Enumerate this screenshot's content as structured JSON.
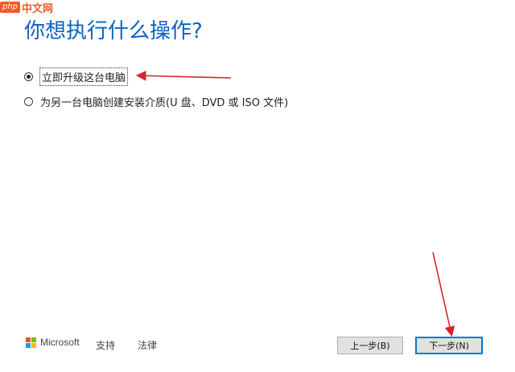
{
  "watermark": {
    "logo": "php",
    "text": "中文网"
  },
  "heading": "你想执行什么操作?",
  "options": [
    {
      "label": "立即升级这台电脑",
      "checked": true
    },
    {
      "label": "为另一台电脑创建安装介质(U 盘、DVD 或 ISO 文件)",
      "checked": false
    }
  ],
  "footer": {
    "brand": "Microsoft",
    "brand_colors": [
      "#f25022",
      "#7fba00",
      "#00a4ef",
      "#ffb900"
    ],
    "support": "支持",
    "legal": "法律"
  },
  "buttons": {
    "back": "上一步(B)",
    "next": "下一步(N)"
  },
  "annotation_color": "#d9232e"
}
